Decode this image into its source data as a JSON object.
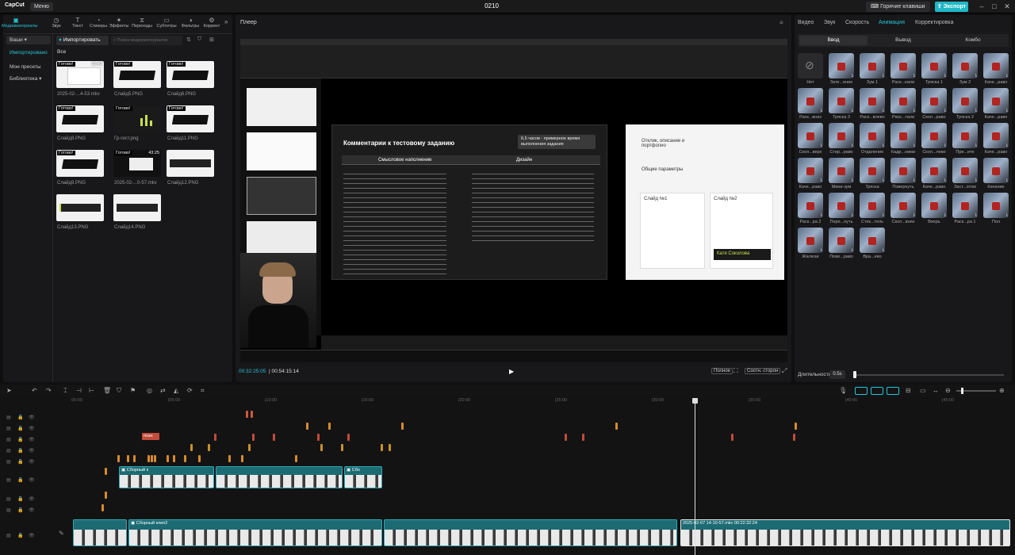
{
  "titlebar": {
    "app": "CapCut",
    "menu": "Меню",
    "project": "0210",
    "hotkeys": "Горячие клавиши",
    "export": "Экспорт"
  },
  "left_tabs": [
    {
      "label": "Медиаматериалы",
      "icon": "media-icon"
    },
    {
      "label": "Звук",
      "icon": "audio-icon"
    },
    {
      "label": "Текст",
      "icon": "text-icon"
    },
    {
      "label": "Стикеры",
      "icon": "sticker-icon"
    },
    {
      "label": "Эффекты",
      "icon": "effects-icon"
    },
    {
      "label": "Переходы",
      "icon": "transitions-icon"
    },
    {
      "label": "Субтитры",
      "icon": "subtitles-icon"
    },
    {
      "label": "Фильтры",
      "icon": "filters-icon"
    },
    {
      "label": "Коррект",
      "icon": "adjust-icon"
    }
  ],
  "left_nav": {
    "local": "Ваши",
    "imported": "Импортировано",
    "presets": "Мои пресеты",
    "library": "Библиотека"
  },
  "media": {
    "import_label": "Импортировать",
    "search_placeholder": "Поиск медиаматериалов",
    "filter_all": "Все",
    "items": [
      {
        "name": "2025-02-...4-53.mkv",
        "badge": "Готово!",
        "dur": "15:42"
      },
      {
        "name": "Слайд5.PNG",
        "badge": "Готово!",
        "dur": ""
      },
      {
        "name": "Слайд6.PNG",
        "badge": "Готово!",
        "dur": ""
      },
      {
        "name": "Слайд8.PNG",
        "badge": "Готово!",
        "dur": ""
      },
      {
        "name": "Гр-гист.png",
        "badge": "Готово!",
        "dur": ""
      },
      {
        "name": "Слайд11.PNG",
        "badge": "Готово!",
        "dur": ""
      },
      {
        "name": "Слайд9.PNG",
        "badge": "Готово!",
        "dur": ""
      },
      {
        "name": "2025-02-...0-57.mkv",
        "badge": "Готово!",
        "dur": "43:25"
      },
      {
        "name": "Слайд12.PNG",
        "badge": "Готово!",
        "dur": ""
      },
      {
        "name": "Слайд13.PNG",
        "badge": "",
        "dur": ""
      },
      {
        "name": "Слайд14.PNG",
        "badge": "",
        "dur": ""
      }
    ]
  },
  "player": {
    "title": "Плеер",
    "current_time": "00:32:25:05",
    "total_time": "00:54:15:14",
    "quality": "Полное",
    "ratio": "Соотн. сторон",
    "slide_title": "Комментарии к тестовому заданию",
    "slide_note": "6,5 часов - примерное время выполнения задания",
    "col_left": "Смысловое наполнение",
    "col_right": "Дизайн",
    "card_name": "Катя Соколова",
    "card_h1": "Отклик, описание и портфолио",
    "card_h2": "Общие параметры",
    "card_s1": "Слайд №1",
    "card_s2": "Слайд №2"
  },
  "right_tabs": [
    "Видео",
    "Звук",
    "Скорость",
    "Анимация",
    "Корректировка"
  ],
  "right_active": "Анимация",
  "anim_sub": [
    "Ввод",
    "Вывод",
    "Комбо"
  ],
  "anim_items": [
    "Нет",
    "Зате...ение",
    "Зум 1",
    "Раск...кали",
    "Тряска 1",
    "Зум 2",
    "Каче...раво",
    "Раск...вниз",
    "Тряска 3",
    "Раск...влево",
    "Раск...тали",
    "Скол...раво",
    "Тряска 2",
    "Каче...раво",
    "Скол...верх",
    "Стир...раво",
    "Отдаление",
    "Кадр...ними",
    "Скол...лево",
    "При...ите",
    "Каче...раво",
    "Каче...раво",
    "Мини-зум",
    "Тряска",
    "Повернуть",
    "Каче...раво",
    "Заст...отом",
    "Качание",
    "Раск...ра 2",
    "Пере...нуть",
    "Стек...тель",
    "Скол...вниз",
    "Вихрь",
    "Раск...ра 1",
    "Пол",
    "Жалюзи",
    "Пове...раво",
    "Вра...ево"
  ],
  "duration": {
    "label": "Длительность",
    "value": "0.5s"
  },
  "timeline": {
    "ticks": [
      "00:00",
      "|05:00",
      "|10:00",
      "|15:00",
      "|20:00",
      "|25:00",
      "|30:00",
      "|35:00",
      "|40:00",
      "|45:00"
    ],
    "clip_label": "Сборный к",
    "clip_label2": "Сборный клип2",
    "main_clip": "2025-02-07 14-10-57.mkv",
    "main_dur": "00:22:32:24",
    "text_clip": "позн"
  }
}
